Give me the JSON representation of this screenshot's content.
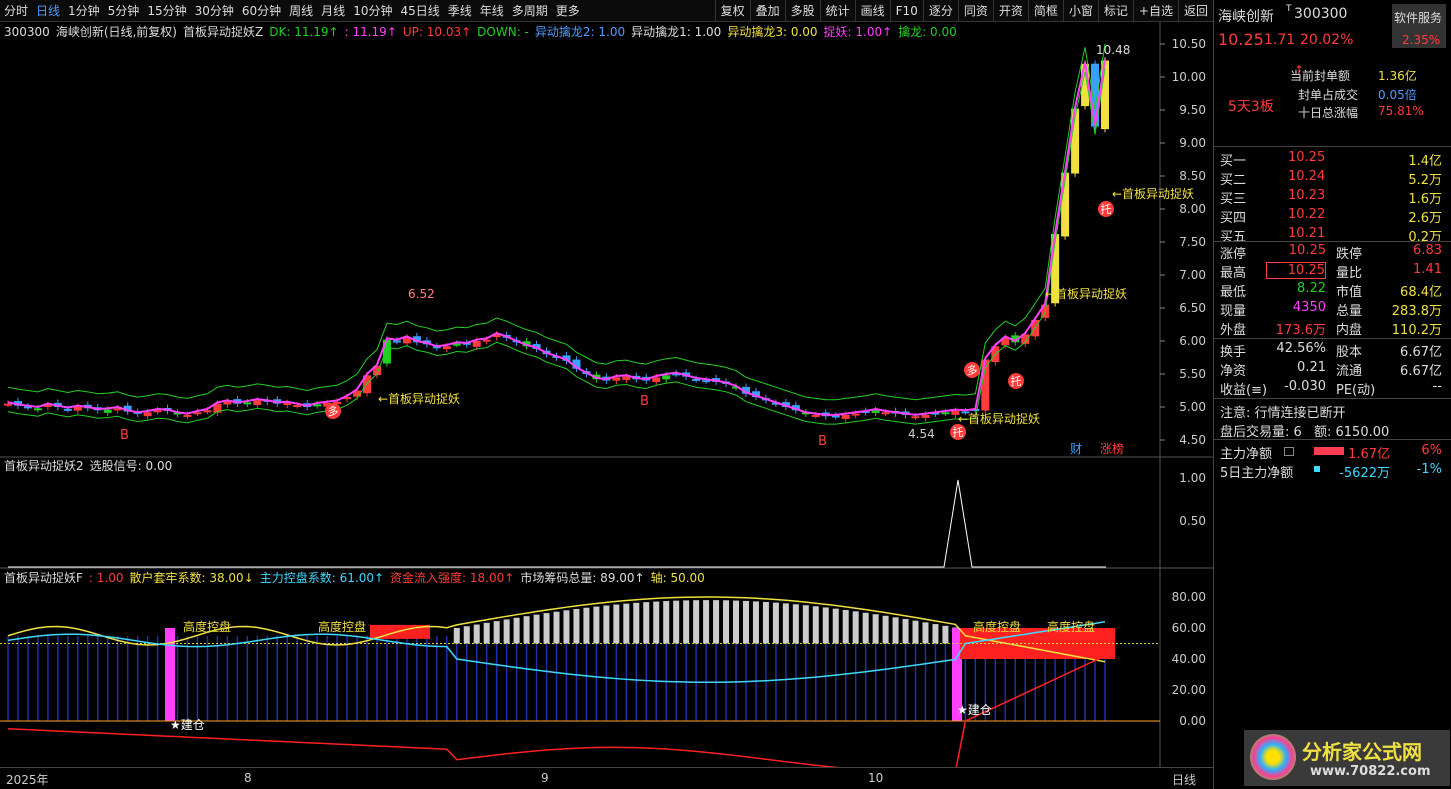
{
  "toolbar": {
    "left": [
      "分时",
      "日线",
      "1分钟",
      "5分钟",
      "15分钟",
      "30分钟",
      "60分钟",
      "周线",
      "月线",
      "10分钟",
      "45日线",
      "季线",
      "年线",
      "多周期",
      "更多"
    ],
    "right": [
      "复权",
      "叠加",
      "多股",
      "统计",
      "画线",
      "F10",
      "逐分",
      "同资",
      "开资",
      "简框",
      "小窗",
      "标记",
      "+自选",
      "返回"
    ]
  },
  "panel1": {
    "code": "300300",
    "name": "海峡创新(日线,前复权)",
    "indicator": "首板异动捉妖Z",
    "dk": "DK: 11.19↑",
    "v2": ": 11.19↑",
    "up": "UP: 10.03↑",
    "down": "DOWN: -",
    "l1": "异动擒龙2: 1.00",
    "l2": "异动擒龙1: 1.00",
    "l3": "异动擒龙3: 0.00",
    "l4": "捉妖: 1.00↑",
    "l5": "擒龙: 0.00",
    "yaxis": [
      "10.50",
      "10.00",
      "9.50",
      "9.00",
      "8.50",
      "8.00",
      "7.50",
      "7.00",
      "6.50",
      "6.00",
      "5.50",
      "5.00",
      "4.50"
    ],
    "high_label": "6.52",
    "low_label": "4.54",
    "top_label": "10.48",
    "sig": "←首板异动捉妖",
    "b": "B",
    "duo": "多",
    "tuo": "托",
    "cai": "财",
    "zhang": "涨榜"
  },
  "panel2": {
    "title": "首板异动捉妖2",
    "sig": "选股信号: 0.00",
    "yaxis": [
      "1.00",
      "0.50"
    ]
  },
  "panel3": {
    "title": "首板异动捉妖F",
    "f": ": 1.00",
    "s1": "散户套牢系数: 38.00↓",
    "s2": "主力控盘系数: 61.00↑",
    "s3": "资金流入强度: 18.00↑",
    "s4": "市场筹码总量: 89.00↑",
    "s5": "轴: 50.00",
    "yaxis": [
      "80.00",
      "60.00",
      "40.00",
      "20.00",
      "0.00"
    ],
    "kong": "高度控盘",
    "jian": "★建仓"
  },
  "xaxis": {
    "labels": [
      "2025年",
      "8",
      "9",
      "10"
    ],
    "period": "日线"
  },
  "quote": {
    "name": "海峡创新",
    "code": "300300",
    "sup": "T",
    "service": "软件服务",
    "svc_pct": "2.35%",
    "price": "10.25",
    "chg": "1.71",
    "pct": "20.02%",
    "streak": "5天3板",
    "feng_lbl": "当前封单额",
    "feng": "1.36亿",
    "fengzhan_lbl": "封单占成交",
    "fengzhan": "0.05倍",
    "ten_lbl": "十日总涨幅",
    "ten": "75.81%",
    "bids": [
      {
        "l": "买一",
        "p": "10.25",
        "v": "1.4亿"
      },
      {
        "l": "买二",
        "p": "10.24",
        "v": "5.2万"
      },
      {
        "l": "买三",
        "p": "10.23",
        "v": "1.6万"
      },
      {
        "l": "买四",
        "p": "10.22",
        "v": "2.6万"
      },
      {
        "l": "买五",
        "p": "10.21",
        "v": "0.2万"
      }
    ],
    "stats": [
      [
        "涨停",
        "10.25",
        "跌停",
        "6.83"
      ],
      [
        "最高",
        "10.25",
        "量比",
        "1.41"
      ],
      [
        "最低",
        "8.22",
        "市值",
        "68.4亿"
      ],
      [
        "现量",
        "4350",
        "总量",
        "283.8万"
      ],
      [
        "外盘",
        "173.6万",
        "内盘",
        "110.2万"
      ]
    ],
    "stats2": [
      [
        "换手",
        "42.56%",
        "股本",
        "6.67亿"
      ],
      [
        "净资",
        "0.21",
        "流通",
        "6.67亿"
      ],
      [
        "收益(≡)",
        "-0.030",
        "PE(动)",
        "--"
      ]
    ],
    "note": "注意: 行情连接已断开",
    "after": "盘后交易量: 6",
    "amount": "额: 6150.00",
    "main_lbl": "主力净额",
    "main_v": "1.67亿",
    "main_p": "6%",
    "main5_lbl": "5日主力净额",
    "main5_v": "-5622万",
    "main5_p": "-1%"
  },
  "watermark": {
    "text": "分析家公式网",
    "url": "www.70822.com"
  }
}
